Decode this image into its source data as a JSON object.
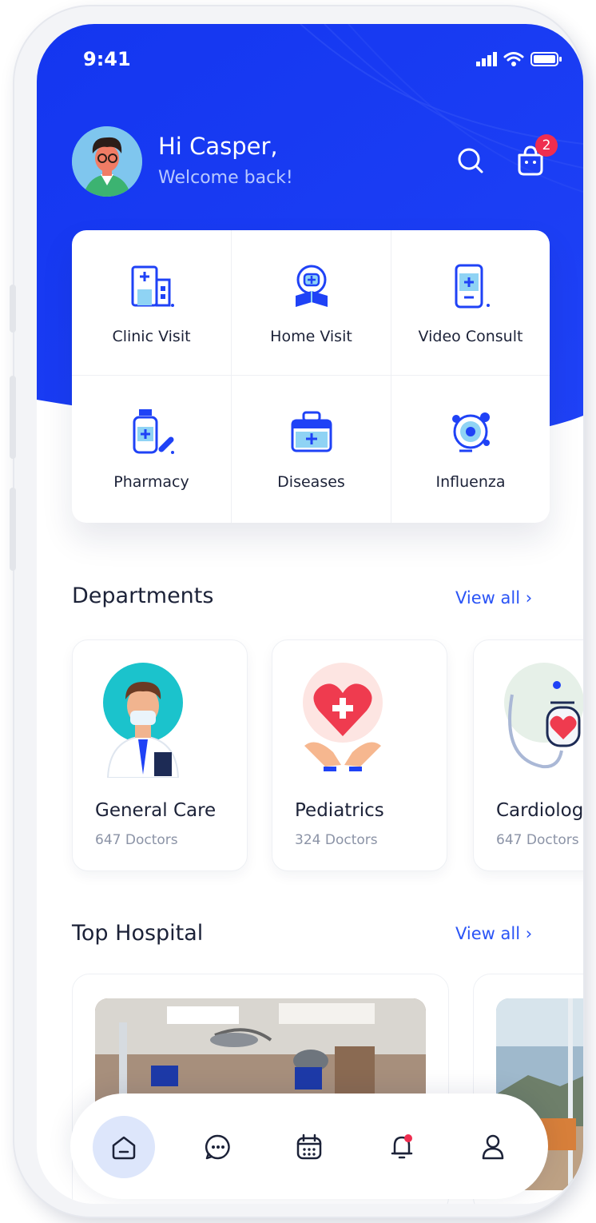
{
  "status": {
    "time": "9:41"
  },
  "header": {
    "greeting": "Hi Casper,",
    "subtitle": "Welcome back!",
    "cart_badge": "2"
  },
  "services": [
    {
      "label": "Clinic Visit",
      "icon": "hospital-building-icon"
    },
    {
      "label": "Home Visit",
      "icon": "home-visit-icon"
    },
    {
      "label": "Video Consult",
      "icon": "phone-consult-icon"
    },
    {
      "label": "Pharmacy",
      "icon": "medicine-bottle-icon"
    },
    {
      "label": "Diseases",
      "icon": "medical-kit-icon"
    },
    {
      "label": "Influenza",
      "icon": "virus-icon"
    }
  ],
  "departments": {
    "title": "Departments",
    "view_all": "View all ›",
    "items": [
      {
        "name": "General Care",
        "count": "647 Doctors"
      },
      {
        "name": "Pediatrics",
        "count": "324 Doctors"
      },
      {
        "name": "Cardiology",
        "count": "647 Doctors"
      }
    ]
  },
  "top_hospital": {
    "title": "Top Hospital",
    "view_all": "View all ›"
  },
  "nav": [
    "home-icon",
    "chat-icon",
    "calendar-icon",
    "notification-bell-icon",
    "profile-icon"
  ],
  "colors": {
    "primary": "#1e3cf2",
    "accent": "#2a54f6",
    "badge": "#ef2d4f",
    "text": "#1c2238",
    "muted": "#8b93a6"
  }
}
